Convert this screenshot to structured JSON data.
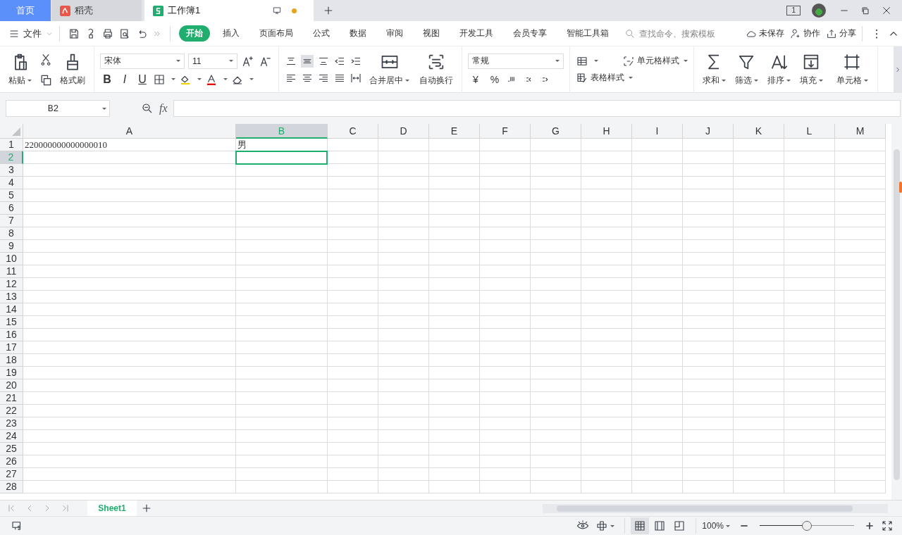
{
  "title_tabs": [
    {
      "label": "首页",
      "kind": "home",
      "selected": false
    },
    {
      "label": "稻壳",
      "kind": "docer",
      "selected": false
    },
    {
      "label": "工作簿1",
      "kind": "sheet",
      "selected": true
    }
  ],
  "window_count": "1",
  "menu": {
    "file": "文件",
    "ribbon_tabs": [
      {
        "label": "开始",
        "selected": true
      },
      {
        "label": "插入",
        "selected": false
      },
      {
        "label": "页面布局",
        "selected": false
      },
      {
        "label": "公式",
        "selected": false
      },
      {
        "label": "数据",
        "selected": false
      },
      {
        "label": "审阅",
        "selected": false
      },
      {
        "label": "视图",
        "selected": false
      },
      {
        "label": "开发工具",
        "selected": false
      },
      {
        "label": "会员专享",
        "selected": false
      },
      {
        "label": "智能工具箱",
        "selected": false
      }
    ],
    "search": {
      "placeholder": "查找命令、搜索模板"
    },
    "actions": [
      {
        "label": "未保存",
        "kind": "cloud"
      },
      {
        "label": "协作",
        "kind": "collab"
      },
      {
        "label": "分享",
        "kind": "share"
      }
    ]
  },
  "ribbon": {
    "paste": "粘贴",
    "format_painter": "格式刷",
    "font": "宋体",
    "font_size": "11",
    "style_buttons": [
      "B",
      "I",
      "U"
    ],
    "merge": "合并居中",
    "wrap": "自动换行",
    "number_format": "常规",
    "number_symbols": [
      "¥",
      "%"
    ],
    "cell_style": "单元格样式",
    "table_style": "表格样式",
    "tools": [
      {
        "label": "求和",
        "kind": "sum"
      },
      {
        "label": "筛选",
        "kind": "filter"
      },
      {
        "label": "排序",
        "kind": "sort"
      },
      {
        "label": "填充",
        "kind": "fill"
      },
      {
        "label": "单元格",
        "kind": "cell"
      }
    ]
  },
  "formula_bar": {
    "name_box": "B2",
    "fx": "fx"
  },
  "columns": [
    {
      "label": "A",
      "selected": false
    },
    {
      "label": "B",
      "selected": true
    },
    {
      "label": "C",
      "selected": false
    },
    {
      "label": "D",
      "selected": false
    },
    {
      "label": "E",
      "selected": false
    },
    {
      "label": "F",
      "selected": false
    },
    {
      "label": "G",
      "selected": false
    },
    {
      "label": "H",
      "selected": false
    },
    {
      "label": "I",
      "selected": false
    },
    {
      "label": "J",
      "selected": false
    },
    {
      "label": "K",
      "selected": false
    },
    {
      "label": "L",
      "selected": false
    },
    {
      "label": "M",
      "selected": false
    }
  ],
  "rows": [
    {
      "label": "1",
      "selected": false,
      "cells": [
        "220000000000000010",
        "男"
      ]
    },
    {
      "label": "2",
      "selected": true,
      "cells": []
    },
    {
      "label": "3",
      "selected": false,
      "cells": []
    },
    {
      "label": "4",
      "selected": false,
      "cells": []
    },
    {
      "label": "5",
      "selected": false,
      "cells": []
    },
    {
      "label": "6",
      "selected": false,
      "cells": []
    },
    {
      "label": "7",
      "selected": false,
      "cells": []
    },
    {
      "label": "8",
      "selected": false,
      "cells": []
    },
    {
      "label": "9",
      "selected": false,
      "cells": []
    },
    {
      "label": "10",
      "selected": false,
      "cells": []
    },
    {
      "label": "11",
      "selected": false,
      "cells": []
    },
    {
      "label": "12",
      "selected": false,
      "cells": []
    },
    {
      "label": "13",
      "selected": false,
      "cells": []
    },
    {
      "label": "14",
      "selected": false,
      "cells": []
    },
    {
      "label": "15",
      "selected": false,
      "cells": []
    },
    {
      "label": "16",
      "selected": false,
      "cells": []
    },
    {
      "label": "17",
      "selected": false,
      "cells": []
    },
    {
      "label": "18",
      "selected": false,
      "cells": []
    },
    {
      "label": "19",
      "selected": false,
      "cells": []
    },
    {
      "label": "20",
      "selected": false,
      "cells": []
    },
    {
      "label": "21",
      "selected": false,
      "cells": []
    },
    {
      "label": "22",
      "selected": false,
      "cells": []
    },
    {
      "label": "23",
      "selected": false,
      "cells": []
    },
    {
      "label": "24",
      "selected": false,
      "cells": []
    },
    {
      "label": "25",
      "selected": false,
      "cells": []
    },
    {
      "label": "26",
      "selected": false,
      "cells": []
    },
    {
      "label": "27",
      "selected": false,
      "cells": []
    },
    {
      "label": "28",
      "selected": false,
      "cells": []
    }
  ],
  "sheet_tabs": [
    {
      "label": "Sheet1",
      "selected": true
    }
  ],
  "status_bar": {
    "views": [
      {
        "kind": "normal",
        "selected": true
      },
      {
        "kind": "page",
        "selected": false
      },
      {
        "kind": "break",
        "selected": false
      }
    ],
    "zoom": "100%",
    "zoom_slider": {
      "level": 0.5
    }
  }
}
